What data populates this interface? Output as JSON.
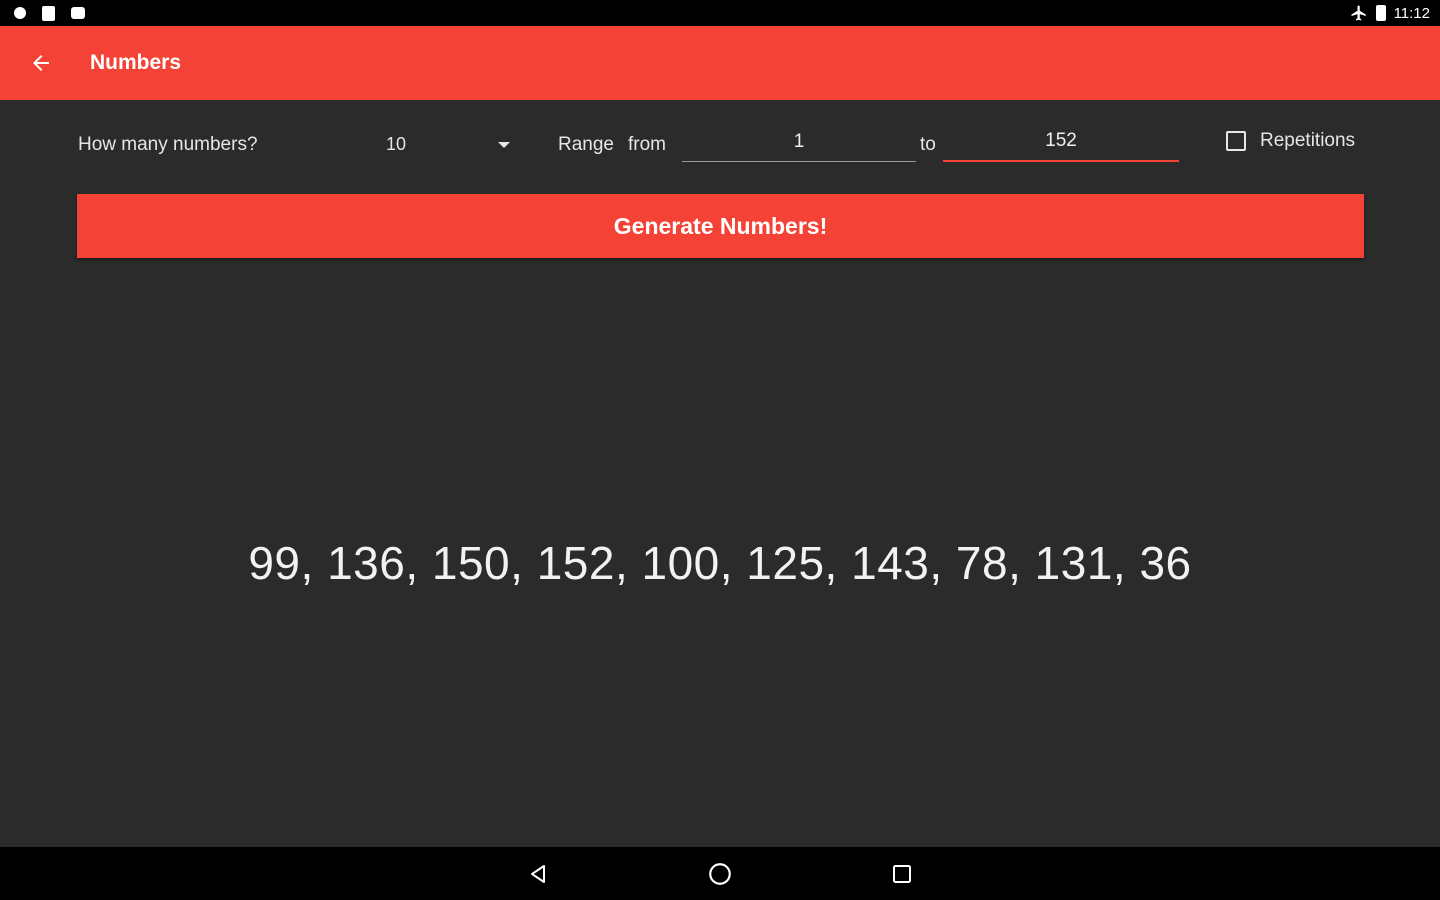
{
  "status_bar": {
    "time": "11:12",
    "left_icons": [
      "notification-icon",
      "sd-card-icon",
      "android-icon"
    ],
    "right_icons": [
      "airplane-mode-icon",
      "battery-icon"
    ]
  },
  "app_bar": {
    "title": "Numbers",
    "back_icon": "arrow-back-icon",
    "color": "#f44336"
  },
  "controls": {
    "count_label": "How many numbers?",
    "count_value": "10",
    "range_label": "Range",
    "from_label": "from",
    "from_value": "1",
    "to_label": "to",
    "to_value": "152",
    "repetitions_label": "Repetitions",
    "repetitions_checked": false
  },
  "generate_button": {
    "label": "Generate Numbers!"
  },
  "result": {
    "text": "99, 136, 150, 152, 100, 125, 143, 78, 131, 36"
  },
  "nav_bar": {
    "icons": [
      "nav-back-icon",
      "nav-home-icon",
      "nav-recents-icon"
    ]
  }
}
